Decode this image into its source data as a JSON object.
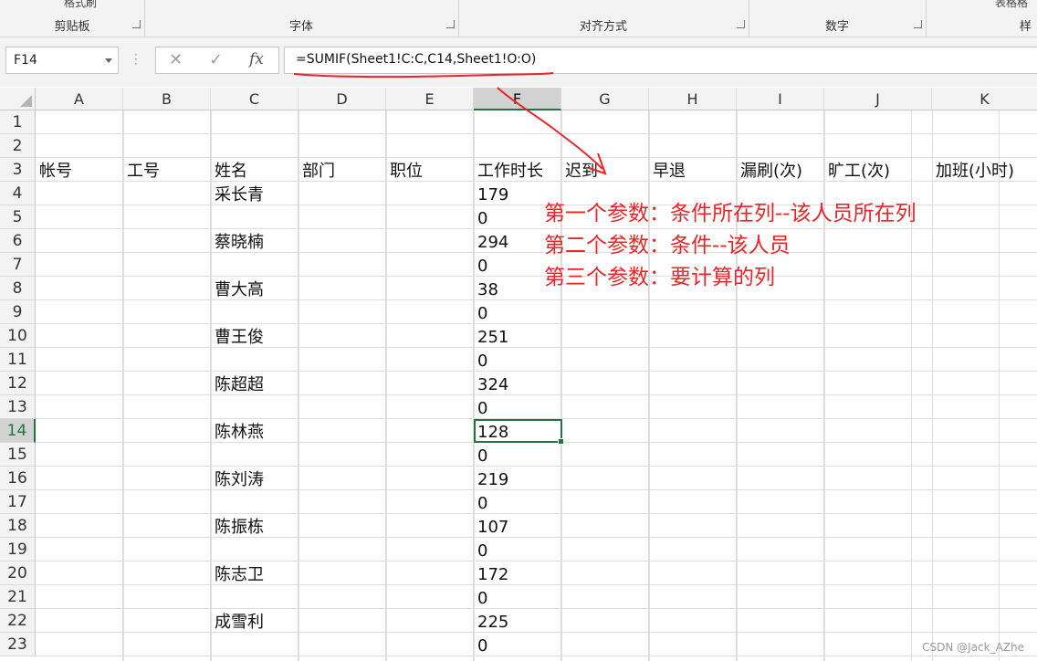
{
  "ribbon": {
    "groups": [
      {
        "label": "剪贴板"
      },
      {
        "label": "字体"
      },
      {
        "label": "对齐方式"
      },
      {
        "label": "数字"
      },
      {
        "label": "样"
      }
    ],
    "partial_top_left": "格式刷",
    "partial_top_right": "表格格"
  },
  "formula_bar": {
    "name_box": "F14",
    "cancel_glyph": "✕",
    "enter_glyph": "✓",
    "fx_glyph": "fx",
    "formula": "=SUMIF(Sheet1!C:C,C14,Sheet1!O:O)"
  },
  "columns": [
    "A",
    "B",
    "C",
    "D",
    "E",
    "F",
    "G",
    "H",
    "I",
    "J",
    "K"
  ],
  "selected_column": "F",
  "rows": [
    "1",
    "2",
    "3",
    "4",
    "5",
    "6",
    "7",
    "8",
    "9",
    "10",
    "11",
    "12",
    "13",
    "14",
    "15",
    "16",
    "17",
    "18",
    "19",
    "20",
    "21",
    "22",
    "23"
  ],
  "selected_row": "14",
  "header_row": [
    "帐号",
    "工号",
    "姓名",
    "部门",
    "职位",
    "工作时长",
    "迟到",
    "早退",
    "漏刷(次)",
    "旷工(次)",
    "加班(小时)"
  ],
  "names": {
    "r4": "采长青",
    "r6": "蔡晓楠",
    "r8": "曹大高",
    "r10": "曹王俊",
    "r12": "陈超超",
    "r14": "陈林燕",
    "r16": "陈刘涛",
    "r18": "陈振栋",
    "r20": "陈志卫",
    "r22": "成雪利"
  },
  "work_hours": {
    "r4": "179",
    "r5": "0",
    "r6": "294",
    "r7": "0",
    "r8": "38",
    "r9": "0",
    "r10": "251",
    "r11": "0",
    "r12": "324",
    "r13": "0",
    "r14": "128",
    "r15": "0",
    "r16": "219",
    "r17": "0",
    "r18": "107",
    "r19": "0",
    "r20": "172",
    "r21": "0",
    "r22": "225",
    "r23": "0"
  },
  "annotations": {
    "line1": "第一个参数：条件所在列--该人员所在列",
    "line2": "第二个参数：条件--该人员",
    "line3": "第三个参数：要计算的列",
    "color": "#e8262a"
  },
  "watermark": "CSDN @Jack_AZhe"
}
